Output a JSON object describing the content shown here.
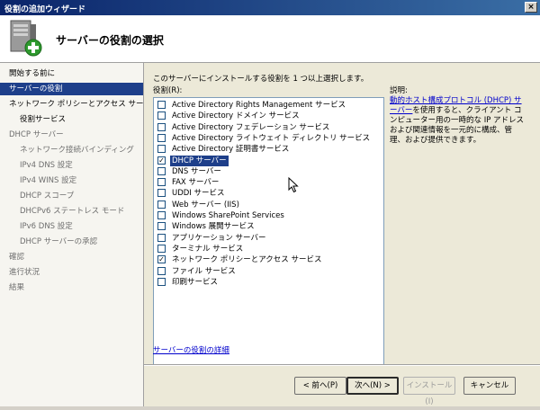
{
  "window": {
    "title": "役割の追加ウィザード",
    "close_glyph": "×"
  },
  "header": {
    "title": "サーバーの役割の選択",
    "icon": "server-add-icon"
  },
  "nav": {
    "items": [
      {
        "label": "開始する前に",
        "level": 0,
        "state": "normal"
      },
      {
        "label": "サーバーの役割",
        "level": 0,
        "state": "active"
      },
      {
        "label": "ネットワーク ポリシーとアクセス サービ...",
        "level": 0,
        "state": "normal"
      },
      {
        "label": "役割サービス",
        "level": 1,
        "state": "normal"
      },
      {
        "label": "DHCP サーバー",
        "level": 0,
        "state": "dim"
      },
      {
        "label": "ネットワーク接続バインディング",
        "level": 1,
        "state": "dim"
      },
      {
        "label": "IPv4 DNS 設定",
        "level": 1,
        "state": "dim"
      },
      {
        "label": "IPv4 WINS 設定",
        "level": 1,
        "state": "dim"
      },
      {
        "label": "DHCP スコープ",
        "level": 1,
        "state": "dim"
      },
      {
        "label": "DHCPv6 ステートレス モード",
        "level": 1,
        "state": "dim"
      },
      {
        "label": "IPv6 DNS 設定",
        "level": 1,
        "state": "dim"
      },
      {
        "label": "DHCP サーバーの承認",
        "level": 1,
        "state": "dim"
      },
      {
        "label": "確認",
        "level": 0,
        "state": "dim"
      },
      {
        "label": "進行状況",
        "level": 0,
        "state": "dim"
      },
      {
        "label": "結果",
        "level": 0,
        "state": "dim"
      }
    ]
  },
  "main": {
    "intro": "このサーバーにインストールする役割を 1 つ以上選択します。",
    "roles_label": "役割(R):",
    "roles": [
      {
        "label": "Active Directory Rights Management サービス",
        "checked": false,
        "selected": false
      },
      {
        "label": "Active Directory ドメイン サービス",
        "checked": false,
        "selected": false
      },
      {
        "label": "Active Directory フェデレーション サービス",
        "checked": false,
        "selected": false
      },
      {
        "label": "Active Directory ライトウェイト ディレクトリ サービス",
        "checked": false,
        "selected": false
      },
      {
        "label": "Active Directory 証明書サービス",
        "checked": false,
        "selected": false
      },
      {
        "label": "DHCP サーバー",
        "checked": true,
        "selected": true
      },
      {
        "label": "DNS サーバー",
        "checked": false,
        "selected": false
      },
      {
        "label": "FAX サーバー",
        "checked": false,
        "selected": false
      },
      {
        "label": "UDDI サービス",
        "checked": false,
        "selected": false
      },
      {
        "label": "Web サーバー (IIS)",
        "checked": false,
        "selected": false
      },
      {
        "label": "Windows SharePoint Services",
        "checked": false,
        "selected": false
      },
      {
        "label": "Windows 展開サービス",
        "checked": false,
        "selected": false
      },
      {
        "label": "アプリケーション サーバー",
        "checked": false,
        "selected": false
      },
      {
        "label": "ターミナル サービス",
        "checked": false,
        "selected": false
      },
      {
        "label": "ネットワーク ポリシーとアクセス サービス",
        "checked": true,
        "selected": false
      },
      {
        "label": "ファイル サービス",
        "checked": false,
        "selected": false
      },
      {
        "label": "印刷サービス",
        "checked": false,
        "selected": false
      }
    ],
    "description": {
      "title": "説明:",
      "link_text": "動的ホスト構成プロトコル (DHCP) サーバー",
      "body": "を使用すると、クライアント コンピューター用の一時的な IP アドレスおよび関連情報を一元的に構成、管理、および提供できます。"
    },
    "details_link": "サーバーの役割の詳細"
  },
  "buttons": {
    "back": "< 前へ(P)",
    "next": "次へ(N) >",
    "install": "インストール(I)",
    "cancel": "キャンセル"
  },
  "check_glyph": "✓"
}
